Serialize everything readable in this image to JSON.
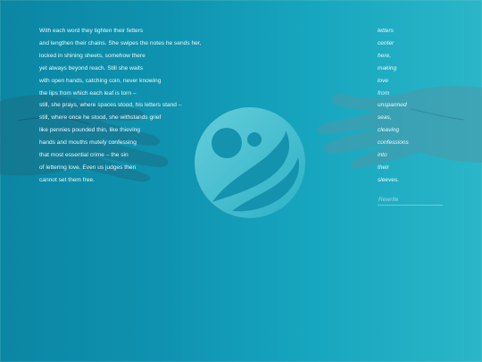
{
  "poem": {
    "lines": [
      "With each word they tighten their fetters",
      "and lengthen their chains. She swipes the notes he sends her,",
      "locked in shining sheets, somehow there",
      "yet always beyond reach. Still she waits",
      "with open hands, catching coin, never knowing",
      "the lips from which each leaf is torn –",
      "still, she prays, where spaces stood, his letters stand –",
      "still, where once he stood, she withstands grief",
      "like pennies pounded thin, like thieving",
      "hands and mouths mutely confessing",
      "that most essential crime – the sin",
      "of lettering love. Even us judges then",
      "cannot set them free."
    ]
  },
  "side_words": [
    "letters",
    "center",
    "here,",
    "making",
    "love",
    "from",
    "unspanned",
    "seas,",
    "cleaving",
    "confessions",
    "into",
    "their",
    "sleeves."
  ],
  "rewrite": {
    "placeholder": "Rewrite"
  },
  "colors": {
    "background_left": "#0b86a3",
    "background_right": "#2bb6c8",
    "text": "#eaf8fb",
    "logo_fill": "#49c3d3"
  },
  "icons": {
    "logo": "abstract-circle-logo-icon",
    "hands": "reaching-hand-icon"
  }
}
